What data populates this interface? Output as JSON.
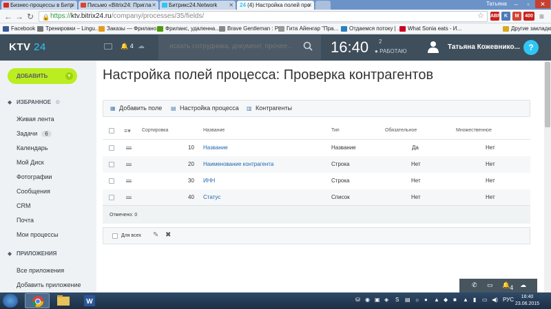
{
  "browser": {
    "tabs": [
      {
        "label": "Бизнес-процессы в Битр",
        "favicon_color": "#d9291f"
      },
      {
        "label": "Письмо «Bitrix24: Пригла",
        "favicon_color": "#d44638"
      },
      {
        "label": "Битрикс24.Network",
        "favicon_color": "#2fc6f6"
      },
      {
        "label": "(4) Настройка полей про",
        "favicon_color": "#2fc6f6",
        "badge": "24"
      }
    ],
    "window_user": "Татьяна",
    "url": {
      "scheme": "https://",
      "host": "ktv.bitrix24.ru",
      "path": "/company/processes/35/fields/"
    },
    "extensions": [
      "ABP",
      "K",
      "M",
      "400"
    ],
    "bookmarks": [
      {
        "label": "Facebook",
        "color": "#3b5998"
      },
      {
        "label": "Тренировки – Lingu...",
        "color": "#777"
      },
      {
        "label": "Заказы — Фрилано...",
        "color": "#e59a1e"
      },
      {
        "label": "Фриланс, удаленна...",
        "color": "#4e9a06"
      },
      {
        "label": "Brave Gentleman : P...",
        "color": "#888"
      },
      {
        "label": "Гита Айенгар \"Пра...",
        "color": "#999"
      },
      {
        "label": "Отдаемся потоку | ...",
        "color": "#2a7fbf"
      },
      {
        "label": "What Sonia eats - И...",
        "color": "#c02"
      },
      {
        "label": "Другие закладки",
        "color": "#d8a81e"
      }
    ]
  },
  "header": {
    "logo_text": "KTV",
    "logo_num": "24",
    "notification_count": "4",
    "search_placeholder": "искать сотрудника, документ, прочее...",
    "time": "16:40",
    "time_badge": "2",
    "work_status": "РАБОТАЮ",
    "user_name": "Татьяна Кожевнико...",
    "help": "?"
  },
  "menu": {
    "add_button": "ДОБАВИТЬ",
    "favorites_title": "ИЗБРАННОЕ",
    "items": [
      {
        "label": "Живая лента"
      },
      {
        "label": "Задачи",
        "count": "6"
      },
      {
        "label": "Календарь"
      },
      {
        "label": "Мой Диск"
      },
      {
        "label": "Фотографии"
      },
      {
        "label": "Сообщения"
      },
      {
        "label": "CRM"
      },
      {
        "label": "Почта"
      },
      {
        "label": "Мои процессы"
      }
    ],
    "apps_title": "ПРИЛОЖЕНИЯ",
    "apps_items": [
      {
        "label": "Все приложения"
      },
      {
        "label": "Добавить приложение"
      }
    ]
  },
  "page": {
    "title": "Настройка полей процесса: Проверка контрагентов",
    "toolbar": {
      "add_field": "Добавить поле",
      "process_settings": "Настройка процесса",
      "contractors": "Контрагенты"
    },
    "grid": {
      "headers": {
        "sort": "Сортировка",
        "name": "Название",
        "type": "Тип",
        "required": "Обязательное",
        "multiple": "Множественное"
      },
      "rows": [
        {
          "sort": "10",
          "name": "Название",
          "type": "Название",
          "required": "Да",
          "multiple": "Нет"
        },
        {
          "sort": "20",
          "name": "Наименование контрагента",
          "type": "Строка",
          "required": "Нет",
          "multiple": "Нет"
        },
        {
          "sort": "30",
          "name": "ИНН",
          "type": "Строка",
          "required": "Нет",
          "multiple": "Нет"
        },
        {
          "sort": "40",
          "name": "Статус",
          "type": "Список",
          "required": "Нет",
          "multiple": "Нет"
        }
      ],
      "selected_label": "Отмечено: 0"
    },
    "actions": {
      "for_all": "Для всех"
    }
  },
  "bottom_bar": {
    "count": "4"
  },
  "taskbar": {
    "lang": "РУС",
    "time": "16:40",
    "date": "23.06.2015"
  }
}
